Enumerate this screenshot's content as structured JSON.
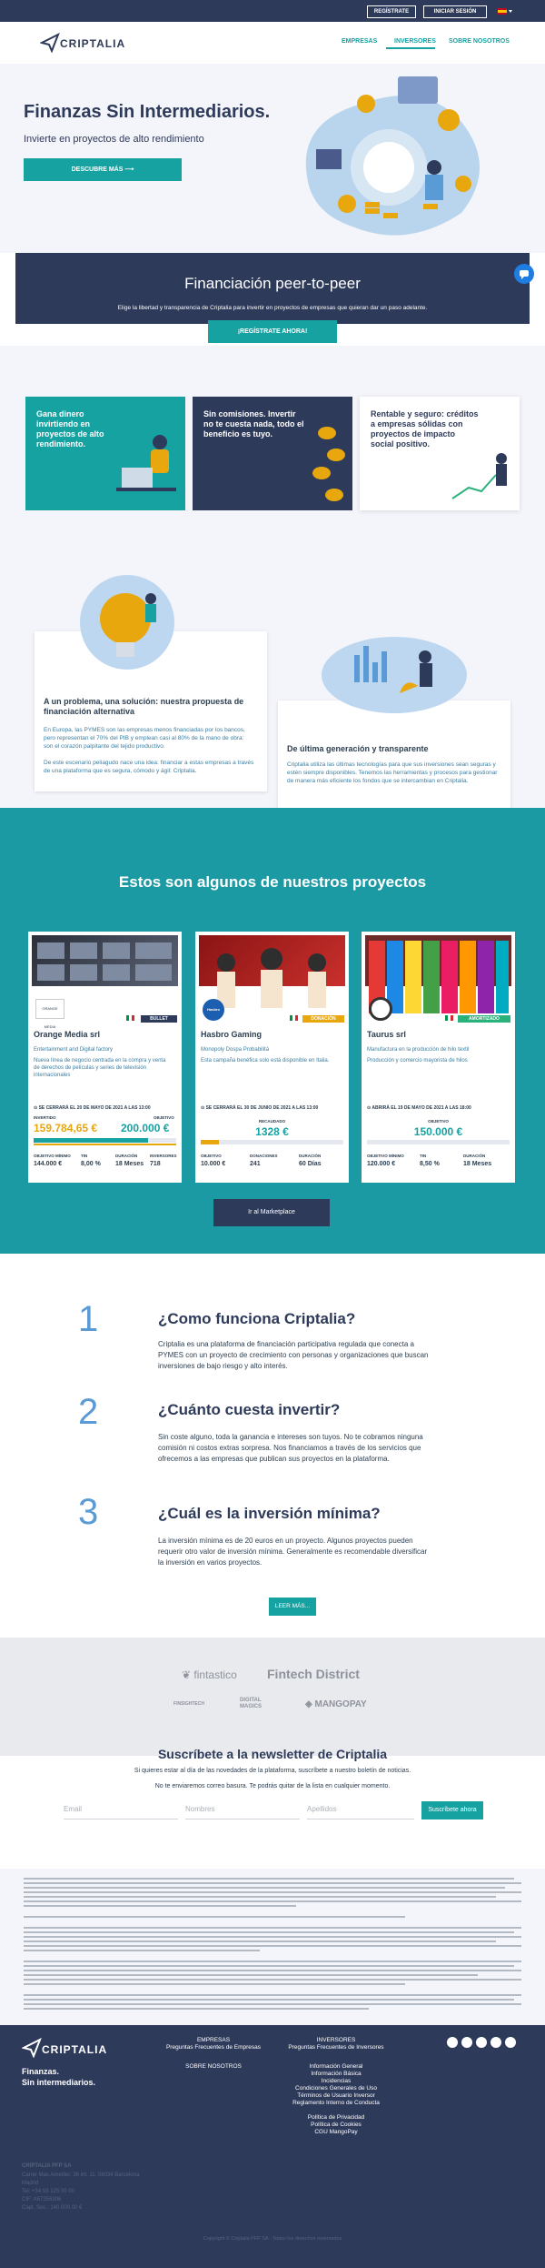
{
  "topbar": {
    "register": "REGÍSTRATE",
    "login": "INICIAR SESIÓN"
  },
  "brand": {
    "name": "CRIPTALIA"
  },
  "nav": {
    "items": [
      "EMPRESAS",
      "INVERSORES",
      "SOBRE NOSOTROS"
    ]
  },
  "hero": {
    "title": "Finanzas Sin Intermediarios.",
    "subtitle": "Invierte en proyectos de alto rendimiento",
    "cta": "DESCUBRE MÁS"
  },
  "p2p": {
    "title": "Financiación peer-to-peer",
    "text": "Elige la libertad y transparencia de Criptalia para invertir en proyectos de empresas que quieran dar un paso adelante.",
    "cta": "¡REGÍSTRATE AHORA!"
  },
  "features": [
    {
      "title": "Gana dinero invirtiendo en proyectos de alto rendimiento."
    },
    {
      "title": "Sin comisiones. Invertir no te cuesta nada, todo el beneficio es tuyo."
    },
    {
      "title": "Rentable y seguro: créditos a empresas sólidas con proyectos de impacto social positivo."
    }
  ],
  "info": [
    {
      "title": "A un problema, una solución: nuestra propuesta de financiación alternativa",
      "p1": "En Europa, las PYMES son las empresas menos financiadas por los bancos, pero representan el 70% del PIB y emplean casi al 80% de la mano de obra: son el corazón palpitante del tejido productivo.",
      "p2": "De este escenario peliagudo nace una idea: financiar a estas empresas a través de una plataforma que es segura, cómodo y ágil: Criptalia."
    },
    {
      "title": "De última generación y transparente",
      "p1": "Criptalia utiliza las últimas tecnologías para que sus inversiones sean seguras y estén siempre disponibles. Tenemos las herramientas y procesos para gestionar de manera más eficiente los fondos que se intercambian en Criptalia."
    }
  ],
  "projects": {
    "title": "Estos son algunos de nuestros proyectos",
    "cta": "Ir al Marketplace",
    "items": [
      {
        "name": "Orange Media srl",
        "ribbon": "BULLET",
        "sector": "Entertainment and Digital factory",
        "desc": "Nueva línea de negocio centrada en la compra y venta de derechos de películas y series de televisión internacionales",
        "date": "SE CERRARÁ EL 20 DE MAYO DE 2021 A LAS 13:00",
        "l1": "INVERTIDO",
        "v1": "159.784,65 €",
        "l2": "OBJETIVO",
        "v2": "200.000 €",
        "progress": 0.8,
        "s": [
          [
            "OBJETIVO MÍNIMO",
            "144.000 €"
          ],
          [
            "TIN",
            "8,00 %"
          ],
          [
            "DURACIÓN",
            "18 Meses"
          ],
          [
            "INVERSORES",
            "718"
          ]
        ]
      },
      {
        "name": "Hasbro Gaming",
        "ribbon": "DONACIÓN",
        "sector": "Monopoly Dospa Probabilitá",
        "desc": "Esta campaña benéfica solo está disponible en Italia.",
        "date": "SE CERRARÁ EL 30 DE JUNIO DE 2021 A LAS 13:00",
        "l1": "RECAUDADO",
        "v1": "1328 €",
        "progress": 0.13,
        "s": [
          [
            "OBJETIVO",
            "10.000 €"
          ],
          [
            "DONACIONES",
            "241"
          ],
          [
            "DURACIÓN",
            "60 Días"
          ]
        ]
      },
      {
        "name": "Taurus srl",
        "ribbon": "AMORTIZADO",
        "sector": "Manufactura en la producción de hilo textil",
        "desc": "Producción y comercio mayorista de hilos",
        "date": "ABRIRÁ EL 19 DE MAYO DE 2021 A LAS 18:00",
        "l1": "OBJETIVO",
        "v1": "150.000 €",
        "progress": 0,
        "s": [
          [
            "OBJETIVO MÍNIMO",
            "120.000 €"
          ],
          [
            "TIN",
            "8,50 %"
          ],
          [
            "DURACIÓN",
            "18 Meses"
          ]
        ]
      }
    ]
  },
  "faq": [
    {
      "n": "1",
      "q": "¿Como funciona Criptalia?",
      "a": "Criptalia es una plataforma de financiación participativa regulada que conecta a PYMES con un proyecto de crecimiento con personas y organizaciones que buscan inversiones de bajo riesgo y alto interés."
    },
    {
      "n": "2",
      "q": "¿Cuánto cuesta invertir?",
      "a": "Sin coste alguno, toda la ganancia e intereses son tuyos. No te cobramos ninguna comisión ni costos extras sorpresa. Nos financiamos a través de los servicios que ofrecemos a las empresas que publican sus proyectos en la plataforma."
    },
    {
      "n": "3",
      "q": "¿Cuál es la inversión mínima?",
      "a": "La inversión mínima es de 20 euros en un proyecto. Algunos proyectos pueden requerir otro valor de inversión mínima. Generalmente es recomendable diversificar la inversión en varios proyectos."
    }
  ],
  "faq_cta": "LEER MÁS...",
  "partners": [
    "fintastico",
    "Fintech District",
    "FINSIGHTECH",
    "DIGITAL MAGICS",
    "MANGOPAY"
  ],
  "newsletter": {
    "title": "Suscríbete a la newsletter de Criptalia",
    "sub1": "Si quieres estar al día de las novedades de la plataforma, suscríbete a nuestro boletín de noticias.",
    "sub2": "No te enviaremos correo basura. Te podrás quitar de la lista en cualquier momento.",
    "ph_email": "Email",
    "ph_name": "Nombres",
    "ph_last": "Apellidos",
    "cta": "Suscríbete ahora"
  },
  "footer": {
    "tagline1": "Finanzas.",
    "tagline2": "Sin intermediarios.",
    "col1": [
      "EMPRESAS",
      "Preguntas Frecuentes de Empresas",
      "SOBRE NOSOTROS"
    ],
    "col2": [
      "INVERSORES",
      "Preguntas Frecuentes de Inversores",
      "Información General",
      "Información Básica",
      "Incidencias",
      "Condiciones Generales de Uso",
      "Términos de Usuario Inversor",
      "Reglamento Interno de Conducta",
      "Política de Privacidad",
      "Política de Cookies",
      "CGU MangoPay"
    ],
    "company": [
      "CRIPTALIA PFP SA",
      "Carrer Mas Ametller, 36 int. 11, 08034 Barcelona",
      "Madrid",
      "Tel: +34 93 125 00 00",
      "CIF: A67356306",
      "Capt. Soc.: 140.000,00 €"
    ],
    "copyright": "Copyright © Criptalia PFP SA - Todos los derechos reservados"
  },
  "colors": {
    "navy": "#2e3a5a",
    "teal": "#17a2a2",
    "orange": "#e8a70d",
    "light": "#f4f5fa"
  }
}
